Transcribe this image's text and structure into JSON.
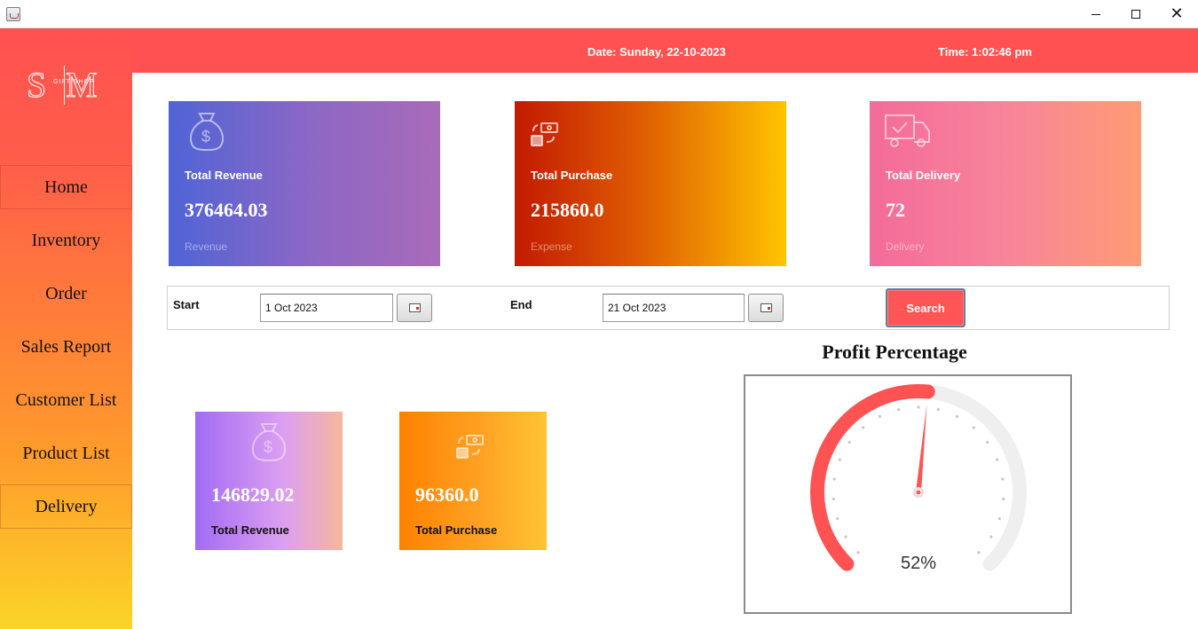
{
  "window": {
    "minimize": "minimize",
    "maximize": "maximize",
    "close": "✕"
  },
  "header": {
    "date": "Date: Sunday, 22-10-2023",
    "time": "Time: 1:02:46 pm"
  },
  "logo": {
    "initials": "SM",
    "subtitle": "GIFT SHOP"
  },
  "sidebar": {
    "items": [
      {
        "label": "Home"
      },
      {
        "label": "Inventory"
      },
      {
        "label": "Order"
      },
      {
        "label": "Sales Report"
      },
      {
        "label": "Customer List"
      },
      {
        "label": "Product List"
      },
      {
        "label": "Delivery"
      }
    ]
  },
  "cards": {
    "revenue": {
      "label": "Total Revenue",
      "value": "376464.03",
      "sub": "Revenue",
      "icon": "money-bag-icon"
    },
    "purchase": {
      "label": "Total Purchase",
      "value": "215860.0",
      "sub": "Expense",
      "icon": "exchange-icon"
    },
    "delivery": {
      "label": "Total Delivery",
      "value": "72",
      "sub": "Delivery",
      "icon": "truck-icon"
    }
  },
  "filter": {
    "start_label": "Start",
    "start_value": "1 Oct 2023",
    "end_label": "End",
    "end_value": "21 Oct 2023",
    "search_label": "Search"
  },
  "period_cards": {
    "revenue": {
      "label": "Total Revenue",
      "value": "146829.02",
      "icon": "money-bag-icon"
    },
    "purchase": {
      "label": "Total Purchase",
      "value": "96360.0",
      "icon": "exchange-icon"
    }
  },
  "gauge": {
    "title": "Profit Percentage",
    "value": 52,
    "value_text": "52%",
    "accent": "#ff5252",
    "track": "#efefef"
  }
}
